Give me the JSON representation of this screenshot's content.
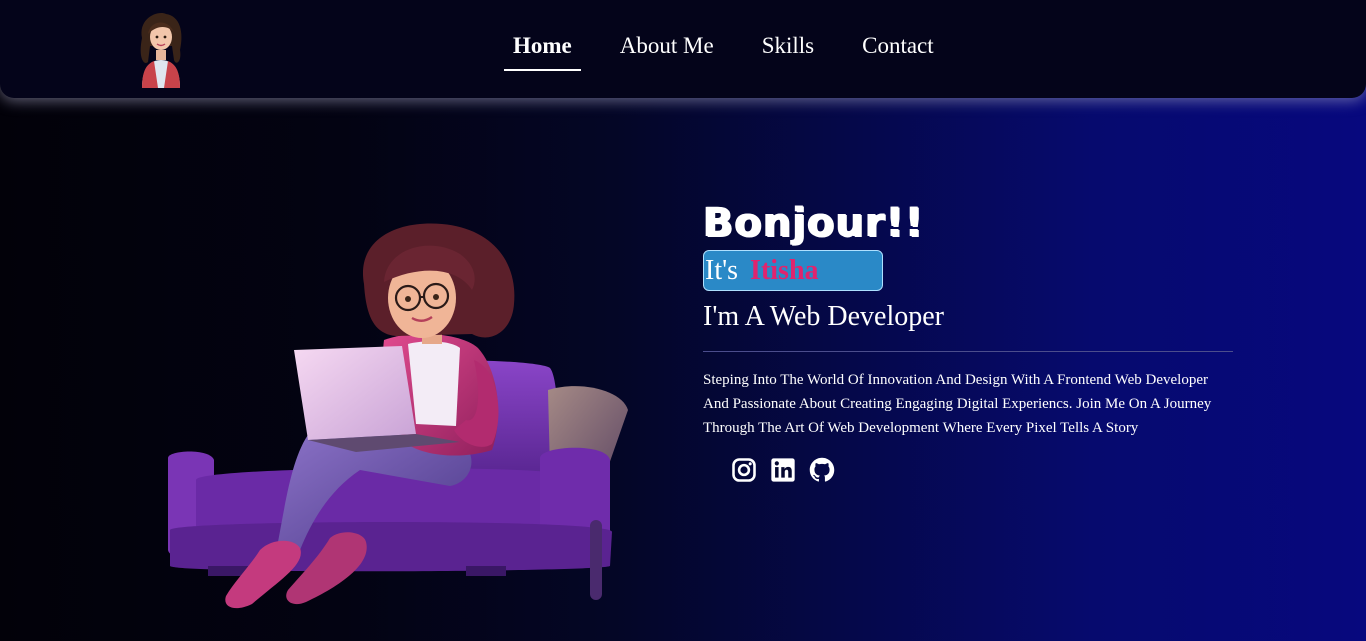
{
  "nav": {
    "logo_alt": "avatar",
    "links": [
      "Home",
      "About Me",
      "Skills",
      "Contact"
    ],
    "active": "Home"
  },
  "hero": {
    "greeting": "Bonjour!!",
    "intro_prefix": "It's",
    "name": "Itisha",
    "role": "I'm A Web Developer",
    "bio": "Steping Into The World Of Innovation And Design With A Frontend Web Developer And Passionate About Creating Engaging Digital Experiencs. Join Me On A Journey Through The Art Of Web Development Where Every Pixel Tells A Story",
    "socials": [
      "instagram-icon",
      "linkedin-icon",
      "github-icon"
    ]
  },
  "colors": {
    "navbar_bg": "#04041a",
    "name_accent": "#e0246e",
    "intro_box_bg": "#2a89c7",
    "sofa": "#7b2fbf",
    "jacket": "#c42f7a"
  }
}
